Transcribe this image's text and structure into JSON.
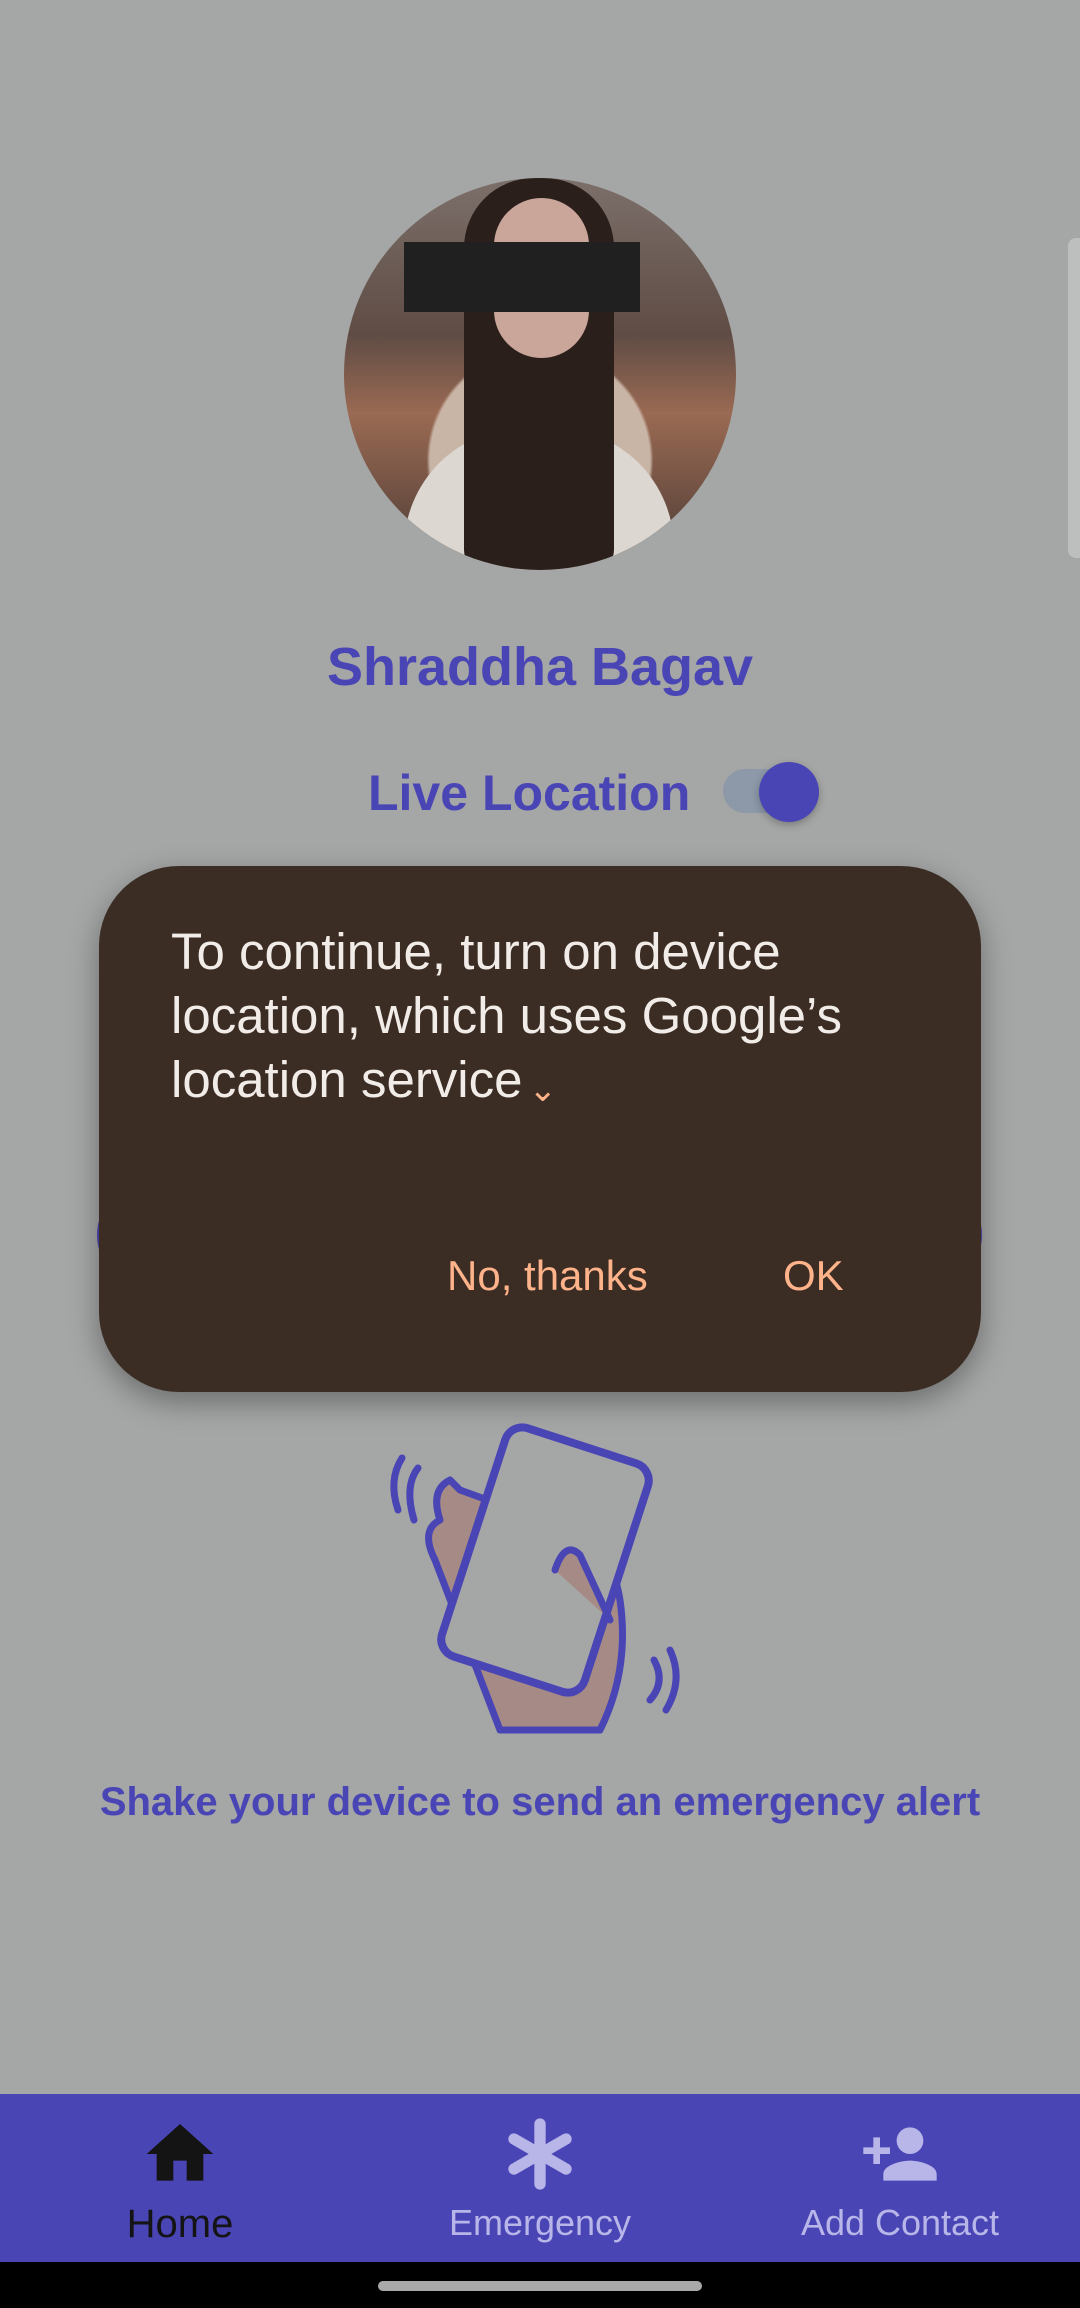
{
  "profile": {
    "name": "Shraddha Bagav"
  },
  "live_location": {
    "label": "Live Location",
    "enabled": true
  },
  "dialog": {
    "message": "To continue, turn on device location, which uses Google’s location service",
    "negative_button": "No, thanks",
    "positive_button": "OK"
  },
  "shake": {
    "text": "Shake your device to send an emergency alert"
  },
  "bottom_nav": {
    "items": [
      {
        "label": "Home",
        "icon": "home-icon",
        "selected": true
      },
      {
        "label": "Emergency",
        "icon": "asterisk-icon",
        "selected": false
      },
      {
        "label": "Add Contact",
        "icon": "person-add-icon",
        "selected": false
      }
    ]
  },
  "colors": {
    "accent": "#4a45b5",
    "dialog_bg": "#3b2c24",
    "dialog_button": "#ffb38a",
    "scrim": "#a5a6a6"
  }
}
